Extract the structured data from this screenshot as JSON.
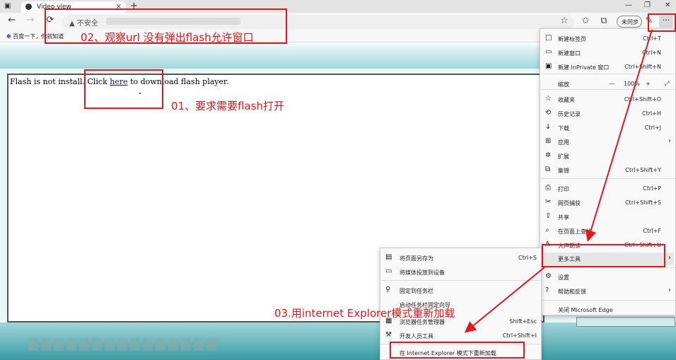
{
  "tab": {
    "title": "Video view",
    "close": "×",
    "new_tab": "+"
  },
  "window_controls": {
    "min": "—",
    "max": "❐",
    "close": "✕"
  },
  "nav": {
    "back": "←",
    "forward": "→",
    "refresh": "⟳"
  },
  "address": {
    "security_label": "不安全",
    "warning_icon": "▲"
  },
  "toolbar": {
    "sync_label": "未同步",
    "more": "···"
  },
  "favorites": {
    "item": "百度一下，你就知道"
  },
  "page": {
    "msg_before": "Flash is not install. Click ",
    "msg_link": "here",
    "msg_after": " to download flash player."
  },
  "annotations": {
    "a01": "01、要求需要flash打开",
    "a02": "02、观察url 没有弹出flash允许窗口",
    "a03": "03.用internet Explorer模式重新加载"
  },
  "menu": {
    "items": [
      {
        "label": "新建标签页",
        "shortcut": "Ctrl+T",
        "icon": "□"
      },
      {
        "label": "新建窗口",
        "shortcut": "Ctrl+N",
        "icon": "▭"
      },
      {
        "label": "新建 InPrivate 窗口",
        "shortcut": "Ctrl+Shift+N",
        "icon": "▣"
      },
      {
        "label": "缩放",
        "icon": ""
      },
      {
        "label": "收藏夹",
        "shortcut": "Ctrl+Shift+O",
        "icon": "☆"
      },
      {
        "label": "历史记录",
        "shortcut": "Ctrl+H",
        "icon": "⟲"
      },
      {
        "label": "下载",
        "shortcut": "Ctrl+J",
        "icon": "↓"
      },
      {
        "label": "应用",
        "icon": "⊞"
      },
      {
        "label": "扩展",
        "icon": "✲"
      },
      {
        "label": "集锦",
        "shortcut": "Ctrl+Shift+Y",
        "icon": "⧉"
      },
      {
        "label": "打印",
        "shortcut": "Ctrl+P",
        "icon": "⎙"
      },
      {
        "label": "网页捕获",
        "shortcut": "Ctrl+Shift+S",
        "icon": "✂"
      },
      {
        "label": "共享",
        "icon": "⇪"
      },
      {
        "label": "在页面上查找",
        "shortcut": "Ctrl+F",
        "icon": "⌕"
      },
      {
        "label": "大声朗读",
        "shortcut": "Ctrl+Shift+U",
        "icon": "A"
      },
      {
        "label": "更多工具",
        "icon": ""
      },
      {
        "label": "设置",
        "icon": "⚙"
      },
      {
        "label": "帮助和反馈",
        "icon": "?"
      },
      {
        "label": "关闭 Microsoft Edge",
        "icon": ""
      }
    ],
    "zoom": {
      "minus": "—",
      "value": "100%",
      "plus": "+",
      "full": "⤢"
    },
    "chevron": "›"
  },
  "submenu": {
    "items": [
      {
        "label": "将页面另存为",
        "shortcut": "Ctrl+S",
        "icon": "▤"
      },
      {
        "label": "将媒体投放到设备",
        "icon": "▭"
      },
      {
        "label": "固定到任务栏",
        "icon": "⚲"
      },
      {
        "label": "启动任务栏固定向导",
        "icon": ""
      },
      {
        "label": "浏览器任务管理器",
        "shortcut": "Shift+Esc",
        "icon": "▦"
      },
      {
        "label": "开发人员工具",
        "shortcut": "Ctrl+Shift+I",
        "icon": "⚒"
      },
      {
        "label": "在 Internet Explorer 模式下重新加载",
        "icon": ""
      }
    ]
  },
  "colors": {
    "annotation": "#e8141b",
    "teal": "#3a9aa1"
  }
}
